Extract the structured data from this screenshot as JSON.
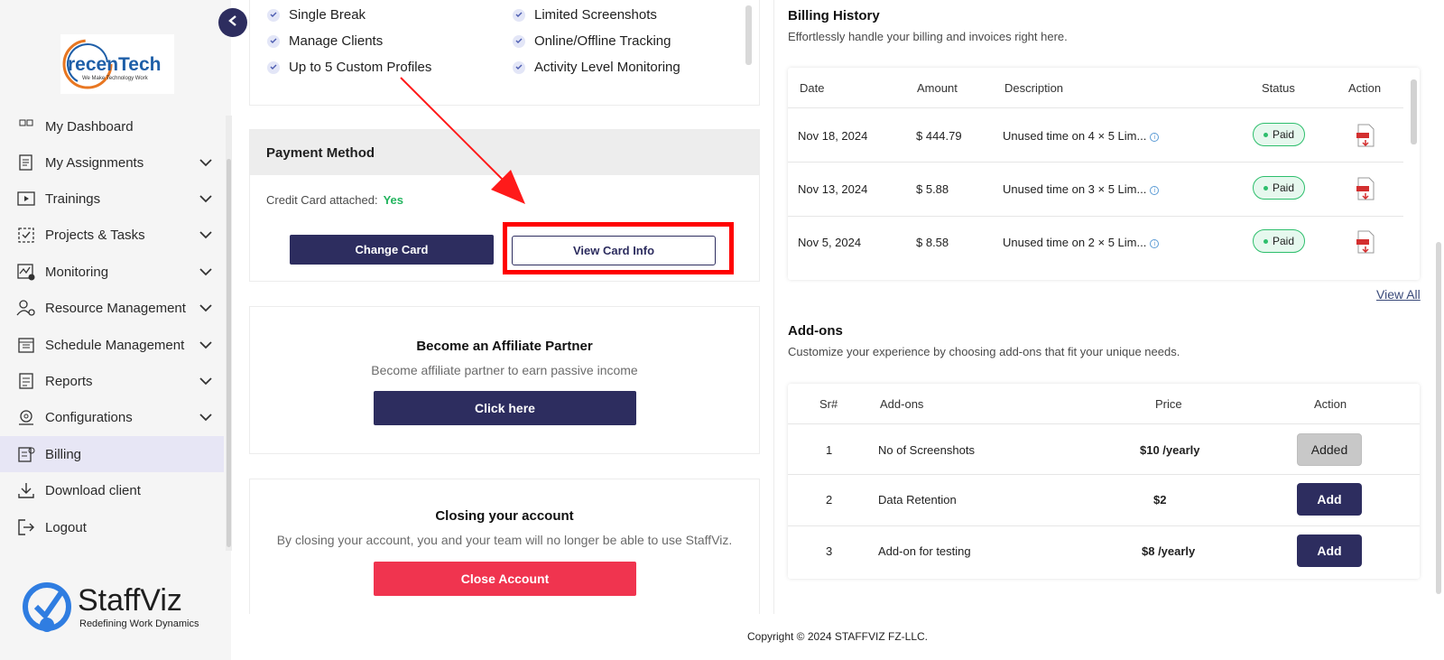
{
  "sidebar": {
    "logo_text": "recenTech",
    "logo_tagline": "We Make Technology Work",
    "items": [
      {
        "label": "My Dashboard",
        "chevron": false
      },
      {
        "label": "My Assignments",
        "chevron": true
      },
      {
        "label": "Trainings",
        "chevron": true
      },
      {
        "label": "Projects & Tasks",
        "chevron": true
      },
      {
        "label": "Monitoring",
        "chevron": true
      },
      {
        "label": "Resource Management",
        "chevron": true
      },
      {
        "label": "Schedule Management",
        "chevron": true
      },
      {
        "label": "Reports",
        "chevron": true
      },
      {
        "label": "Configurations",
        "chevron": true
      },
      {
        "label": "Billing",
        "chevron": false
      },
      {
        "label": "Download client",
        "chevron": false
      },
      {
        "label": "Logout",
        "chevron": false
      }
    ],
    "brand_name": "StaffViz",
    "brand_tagline": "Redefining Work Dynamics"
  },
  "plan": {
    "features": [
      "Single Break",
      "Limited Screenshots",
      "Manage Clients",
      "Online/Offline Tracking",
      "Up to 5 Custom Profiles",
      "Activity Level Monitoring"
    ]
  },
  "payment": {
    "title": "Payment Method",
    "cc_label": "Credit Card attached:",
    "cc_value": "Yes",
    "change_label": "Change Card",
    "view_label": "View Card Info"
  },
  "affiliate": {
    "title": "Become an Affiliate Partner",
    "subtitle": "Become affiliate partner to earn passive income",
    "button": "Click here"
  },
  "closing": {
    "title": "Closing your account",
    "subtitle": "By closing your account, you and your team will no longer be able to use StaffViz.",
    "button": "Close Account"
  },
  "billing": {
    "title": "Billing History",
    "subtitle": "Effortlessly handle your billing and invoices right here.",
    "columns": [
      "Date",
      "Amount",
      "Description",
      "Status",
      "Action"
    ],
    "rows": [
      {
        "date": "Nov 18, 2024",
        "amount": "$ 444.79",
        "description": "Unused time on 4 × 5 Lim...",
        "status": "Paid"
      },
      {
        "date": "Nov 13, 2024",
        "amount": "$ 5.88",
        "description": "Unused time on 3 × 5 Lim...",
        "status": "Paid"
      },
      {
        "date": "Nov 5, 2024",
        "amount": "$ 8.58",
        "description": "Unused time on 2 × 5 Lim...",
        "status": "Paid"
      }
    ],
    "view_all": "View All"
  },
  "addons": {
    "title": "Add-ons",
    "subtitle": "Customize your experience by choosing add-ons that fit your unique needs.",
    "columns": [
      "Sr#",
      "Add-ons",
      "Price",
      "Action"
    ],
    "rows": [
      {
        "sr": "1",
        "name": "No of Screenshots",
        "price": "$10 /yearly",
        "action": "Added"
      },
      {
        "sr": "2",
        "name": "Data Retention",
        "price": "$2",
        "action": "Add"
      },
      {
        "sr": "3",
        "name": "Add-on for testing",
        "price": "$8 /yearly",
        "action": "Add"
      }
    ]
  },
  "footer": {
    "copyright": "Copyright © 2024 STAFFVIZ FZ-LLC."
  },
  "colors": {
    "primary": "#2d2d5f",
    "danger": "#f0344f",
    "success": "#22b45e",
    "highlight": "#ff0000"
  }
}
